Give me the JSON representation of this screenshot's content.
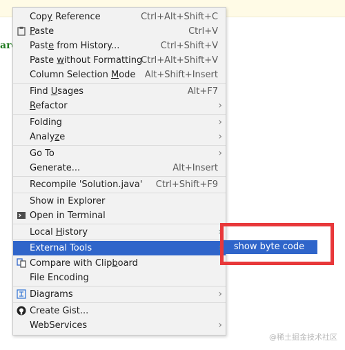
{
  "editor": {
    "fragment_text": "arc"
  },
  "menu": {
    "items": [
      {
        "name": "copy-reference",
        "pre": "Cop",
        "acc": "y",
        "post": " Reference",
        "shortcut": "Ctrl+Alt+Shift+C"
      },
      {
        "name": "paste",
        "pre": "",
        "acc": "P",
        "post": "aste",
        "shortcut": "Ctrl+V",
        "icon": "clipboard-icon"
      },
      {
        "name": "paste-from-history",
        "pre": "Past",
        "acc": "e",
        "post": " from History...",
        "shortcut": "Ctrl+Shift+V"
      },
      {
        "name": "paste-without-formatting",
        "pre": "Paste ",
        "acc": "w",
        "post": "ithout Formatting",
        "shortcut": "Ctrl+Alt+Shift+V"
      },
      {
        "name": "column-selection-mode",
        "pre": "Column Selection ",
        "acc": "M",
        "post": "ode",
        "shortcut": "Alt+Shift+Insert"
      },
      {
        "name": "find-usages",
        "pre": "Find ",
        "acc": "U",
        "post": "sages",
        "shortcut": "Alt+F7"
      },
      {
        "name": "refactor",
        "pre": "",
        "acc": "R",
        "post": "efactor",
        "submenu": true
      },
      {
        "name": "folding",
        "pre": "Folding",
        "acc": "",
        "post": "",
        "submenu": true
      },
      {
        "name": "analyze",
        "pre": "Analy",
        "acc": "z",
        "post": "e",
        "submenu": true
      },
      {
        "name": "go-to",
        "pre": "Go To",
        "acc": "",
        "post": "",
        "submenu": true
      },
      {
        "name": "generate",
        "pre": "Generate...",
        "acc": "",
        "post": "",
        "shortcut": "Alt+Insert"
      },
      {
        "name": "recompile",
        "pre": "Recompile 'Solution.java'",
        "acc": "",
        "post": "",
        "shortcut": "Ctrl+Shift+F9"
      },
      {
        "name": "show-in-explorer",
        "pre": "Show in Explorer",
        "acc": "",
        "post": ""
      },
      {
        "name": "open-in-terminal",
        "pre": "Open in Terminal",
        "acc": "",
        "post": "",
        "icon": "terminal-icon"
      },
      {
        "name": "local-history",
        "pre": "Local ",
        "acc": "H",
        "post": "istory",
        "submenu": true
      },
      {
        "name": "external-tools",
        "pre": "External Tools",
        "acc": "",
        "post": "",
        "submenu": true,
        "active": true
      },
      {
        "name": "compare-with-clipboard",
        "pre": "Compare with Clip",
        "acc": "b",
        "post": "oard",
        "icon": "compare-icon"
      },
      {
        "name": "file-encoding",
        "pre": "File Encoding",
        "acc": "",
        "post": ""
      },
      {
        "name": "diagrams",
        "pre": "Diagrams",
        "acc": "",
        "post": "",
        "submenu": true,
        "icon": "diagram-icon"
      },
      {
        "name": "create-gist",
        "pre": "Create Gist...",
        "acc": "",
        "post": "",
        "icon": "github-icon"
      },
      {
        "name": "webservices",
        "pre": "WebServices",
        "acc": "",
        "post": "",
        "submenu": true
      }
    ]
  },
  "submenu": {
    "label": "show byte code"
  },
  "watermark": "@稀土掘金技术社区",
  "colors": {
    "selection": "#2f65ca",
    "annotation": "#e8383a",
    "menu_bg": "#f2f2f2"
  }
}
